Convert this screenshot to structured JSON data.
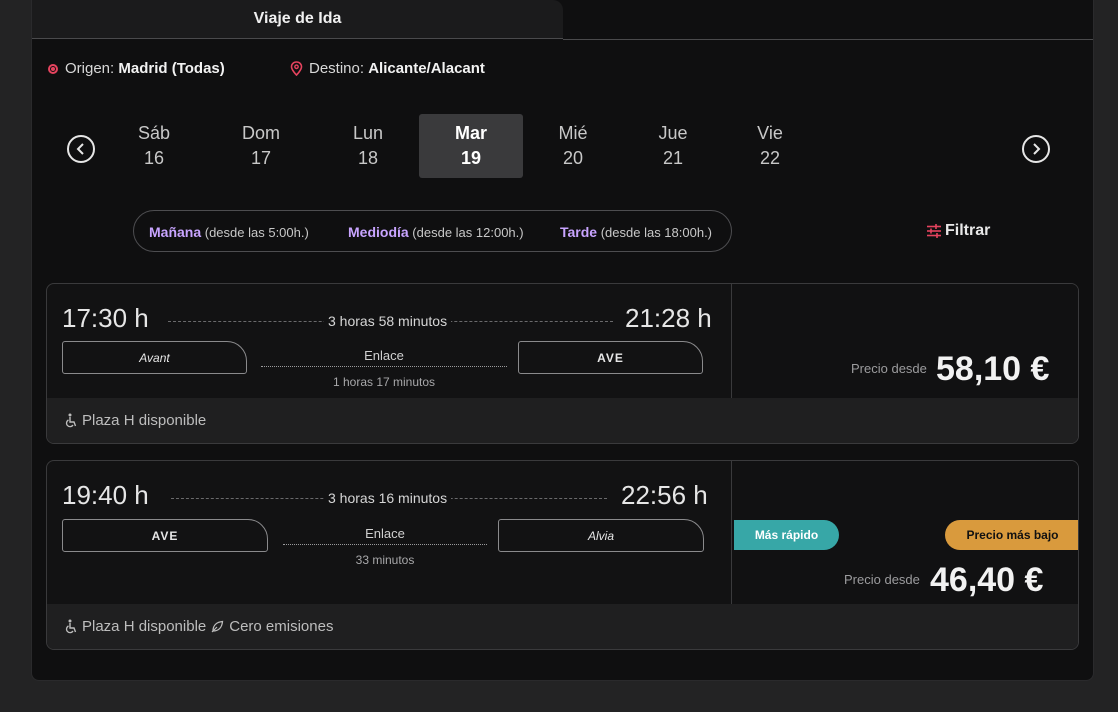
{
  "tab": {
    "label": "Viaje de Ida"
  },
  "route": {
    "origin_label": "Origen:",
    "origin_city": "Madrid",
    "origin_detail": "(Todas)",
    "destination_label": "Destino:",
    "destination_city": "Alicante/Alacant"
  },
  "dates": [
    {
      "name": "Sáb",
      "num": "16",
      "selected": false
    },
    {
      "name": "Dom",
      "num": "17",
      "selected": false
    },
    {
      "name": "Lun",
      "num": "18",
      "selected": false
    },
    {
      "name": "Mar",
      "num": "19",
      "selected": true
    },
    {
      "name": "Mié",
      "num": "20",
      "selected": false
    },
    {
      "name": "Jue",
      "num": "21",
      "selected": false
    },
    {
      "name": "Vie",
      "num": "22",
      "selected": false
    }
  ],
  "time_filters": [
    {
      "label": "Mañana",
      "detail": "(desde las 5:00h.)"
    },
    {
      "label": "Mediodía",
      "detail": "(desde las 12:00h.)"
    },
    {
      "label": "Tarde",
      "detail": "(desde las 18:00h.)"
    }
  ],
  "filter_button": {
    "label": "Filtrar"
  },
  "colors": {
    "accent_purple": "#c8a4ff",
    "accent_red": "#e5435e",
    "badge_fast": "#37a7a7",
    "badge_low": "#d99a3d"
  },
  "trips": [
    {
      "departure": "17:30 h",
      "duration": "3 horas 58 minutos",
      "arrival": "21:28 h",
      "train1": "Avant",
      "train2": "AVE",
      "connection_label": "Enlace",
      "connection_duration": "1 horas 17 minutos",
      "price_label": "Precio desde",
      "price": "58,10 €",
      "features": [
        "Plaza H disponible"
      ]
    },
    {
      "departure": "19:40 h",
      "duration": "3 horas 16 minutos",
      "arrival": "22:56 h",
      "train1": "AVE",
      "train2": "Alvia",
      "connection_label": "Enlace",
      "connection_duration": "33 minutos",
      "badge_fast": "Más rápido",
      "badge_low": "Precio más bajo",
      "price_label": "Precio desde",
      "price": "46,40 €",
      "features": [
        "Plaza H disponible",
        "Cero emisiones"
      ]
    }
  ]
}
